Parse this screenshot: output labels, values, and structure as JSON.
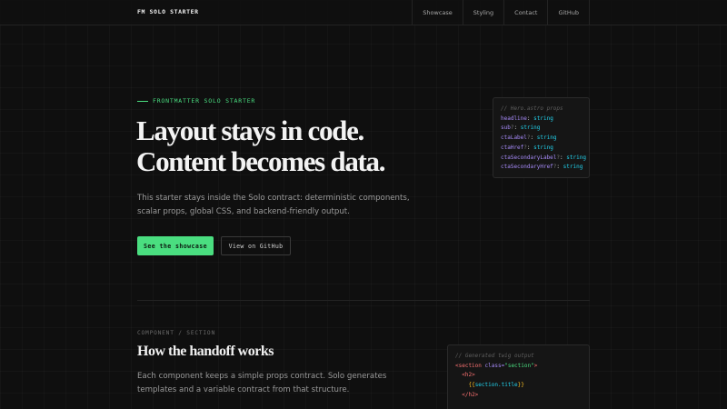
{
  "nav": {
    "brand": "FM SOLO STARTER",
    "links": [
      "Showcase",
      "Styling",
      "Contact",
      "GitHub"
    ]
  },
  "hero": {
    "eyebrow": "FRONTMATTER SOLO STARTER",
    "title_line1": "Layout stays in code.",
    "title_line2": "Content becomes data.",
    "sub": "This starter stays inside the Solo contract: deterministic components, scalar props, global CSS, and backend-friendly output.",
    "cta_label": "See the showcase",
    "cta_secondary_label": "View on GitHub"
  },
  "props_card": {
    "comment": "// Hero.astro props",
    "props": [
      {
        "name": "headline",
        "optional": "",
        "type": "string"
      },
      {
        "name": "sub",
        "optional": "?",
        "type": "string"
      },
      {
        "name": "ctaLabel",
        "optional": "?",
        "type": "string"
      },
      {
        "name": "ctaHref",
        "optional": "?",
        "type": "string"
      },
      {
        "name": "ctaSecondaryLabel",
        "optional": "?",
        "type": "string"
      },
      {
        "name": "ctaSecondaryHref",
        "optional": "?",
        "type": "string"
      }
    ]
  },
  "section": {
    "eyebrow": "COMPONENT / SECTION",
    "title": "How the handoff works",
    "sub": "Each component keeps a simple props contract. Solo generates templates and a variable contract from that structure."
  },
  "template_card": {
    "comment": "// Generated twig output",
    "line1_tag_open": "<section",
    "line1_attr": "class=",
    "line1_str": "\"section\"",
    "line1_close": ">",
    "line2": "<h2>",
    "line3_open": "{{",
    "line3_expr": "section.title",
    "line3_close": "}}",
    "line4": "</h2>"
  },
  "colors": {
    "accent": "#4ade80",
    "background": "#0f0f0f",
    "type": "#22d3ee",
    "key": "#a78bfa",
    "tag": "#f87171"
  }
}
